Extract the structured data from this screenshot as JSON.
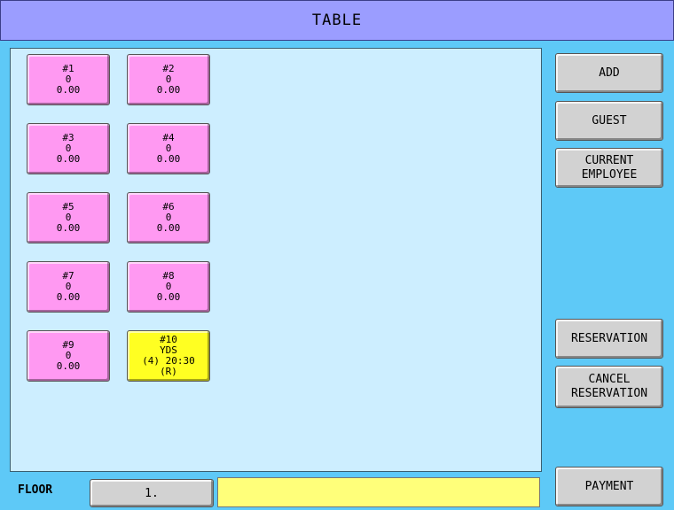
{
  "header": {
    "title": "TABLE"
  },
  "tables": [
    {
      "number": "#1",
      "guests": "0",
      "amount": "0.00",
      "extra": ""
    },
    {
      "number": "#2",
      "guests": "0",
      "amount": "0.00",
      "extra": ""
    },
    {
      "number": "#3",
      "guests": "0",
      "amount": "0.00",
      "extra": ""
    },
    {
      "number": "#4",
      "guests": "0",
      "amount": "0.00",
      "extra": ""
    },
    {
      "number": "#5",
      "guests": "0",
      "amount": "0.00",
      "extra": ""
    },
    {
      "number": "#6",
      "guests": "0",
      "amount": "0.00",
      "extra": ""
    },
    {
      "number": "#7",
      "guests": "0",
      "amount": "0.00",
      "extra": ""
    },
    {
      "number": "#8",
      "guests": "0",
      "amount": "0.00",
      "extra": ""
    },
    {
      "number": "#9",
      "guests": "0",
      "amount": "0.00",
      "extra": ""
    },
    {
      "number": "#10",
      "guests": "YDS",
      "amount": "(4) 20:30",
      "extra": "(R)"
    }
  ],
  "colors": {
    "open_table": "#ff99f2",
    "reserved_table": "#ffff22"
  },
  "sidebar": {
    "add": "ADD",
    "guest": "GUEST",
    "current_employee": "CURRENT\nEMPLOYEE",
    "reservation": "RESERVATION",
    "cancel_reservation": "CANCEL\nRESERVATION",
    "payment": "PAYMENT"
  },
  "footer": {
    "floor_label": "FLOOR",
    "floor_value": "1.",
    "status_text": ""
  }
}
